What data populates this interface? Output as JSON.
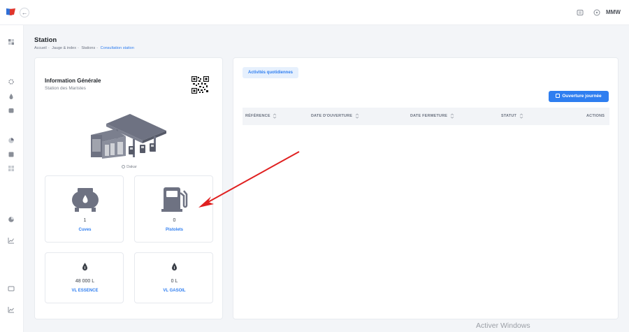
{
  "topbar": {
    "back_icon": "arrow-left-icon",
    "user_initials": "MMW",
    "icons": [
      "message-icon",
      "help-icon"
    ]
  },
  "sidebar": {
    "icons": [
      "dashboard-icon",
      "settings-icon",
      "fuel-drop-icon",
      "tank-icon",
      "pie-chart-icon",
      "document-icon",
      "grid-icon",
      "report-icon",
      "bar-chart-icon",
      "card-icon",
      "line-chart-icon"
    ]
  },
  "page": {
    "title": "Station",
    "breadcrumb": [
      "Accueil",
      "Jauge & index",
      "Stations",
      "Consultation station"
    ],
    "breadcrumb_sep": "-"
  },
  "info": {
    "title": "Information Générale",
    "subtitle": "Station des Maristes",
    "location": "Dakar"
  },
  "stats": {
    "cuves": {
      "value": "1",
      "label": "Cuves"
    },
    "pistolets": {
      "value": "0",
      "label": "Pistolets"
    },
    "essence": {
      "value": "48 000 L",
      "label": "VL ESSENCE"
    },
    "gasoil": {
      "value": "0 L",
      "label": "VL GASOIL"
    }
  },
  "activities": {
    "tab_label": "Activités quotidiennes",
    "open_button": "Ouverture journée",
    "columns": [
      "RÉFÉRENCE",
      "DATE D'OUVERTURE",
      "DATE FERMETURE",
      "STATUT",
      "ACTIONS"
    ]
  },
  "watermark": "Activer Windows",
  "colors": {
    "accent": "#2f7ef0",
    "arrow": "#e02020",
    "icon_gray": "#6e7282"
  }
}
